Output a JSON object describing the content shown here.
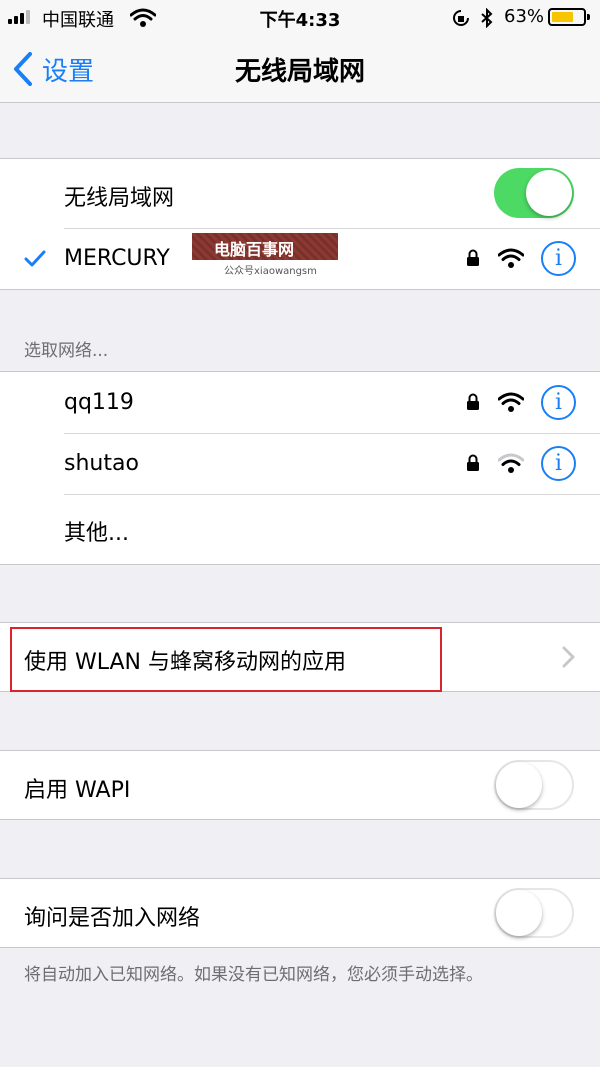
{
  "status_bar": {
    "carrier": "中国联通",
    "time": "下午4:33",
    "battery_percent": "63%",
    "battery_level": 0.63
  },
  "nav": {
    "back_label": "设置",
    "title": "无线局域网"
  },
  "wlan": {
    "label": "无线局域网",
    "enabled": true,
    "connected_network": "MERCURY"
  },
  "choose_header": "选取网络...",
  "networks": [
    {
      "name": "qq119",
      "locked": true,
      "signal": 3
    },
    {
      "name": "shutao",
      "locked": true,
      "signal": 2
    }
  ],
  "other_label": "其他...",
  "apps_row_label": "使用 WLAN 与蜂窝移动网的应用",
  "wapi": {
    "label": "启用 WAPI",
    "enabled": false
  },
  "ask": {
    "label": "询问是否加入网络",
    "enabled": false
  },
  "footer_note": "将自动加入已知网络。如果没有已知网络，您必须手动选择。",
  "watermark": {
    "title": "电脑百事网",
    "subtitle": "公众号xiaowangsm"
  },
  "colors": {
    "accent": "#1a7ff5",
    "toggle_on": "#4cd964",
    "highlight": "#d9232d",
    "battery": "#f7c500"
  },
  "info_glyph": "i"
}
